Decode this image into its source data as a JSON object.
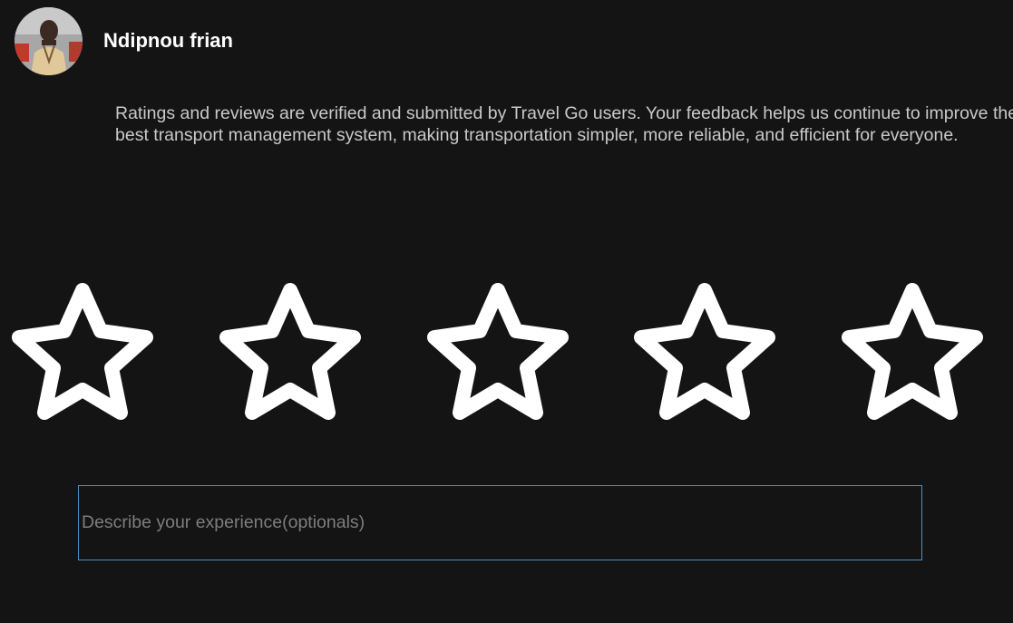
{
  "user": {
    "name": "Ndipnou frian",
    "avatar_icon": "profile-photo"
  },
  "disclaimer": "Ratings and reviews are verified and submitted by Travel Go users. Your feedback helps us continue to improve the best transport management system, making transportation simpler, more reliable, and efficient for everyone.",
  "rating": {
    "max": 5,
    "selected": 0,
    "star_icon": "star-outline-icon",
    "star_color": "#ffffff"
  },
  "review": {
    "value": "",
    "placeholder": "Describe your experience(optionals)",
    "border_color": "#4d8fc7"
  },
  "colors": {
    "background": "#141414",
    "text": "#c9c9c9",
    "title": "#ffffff"
  }
}
